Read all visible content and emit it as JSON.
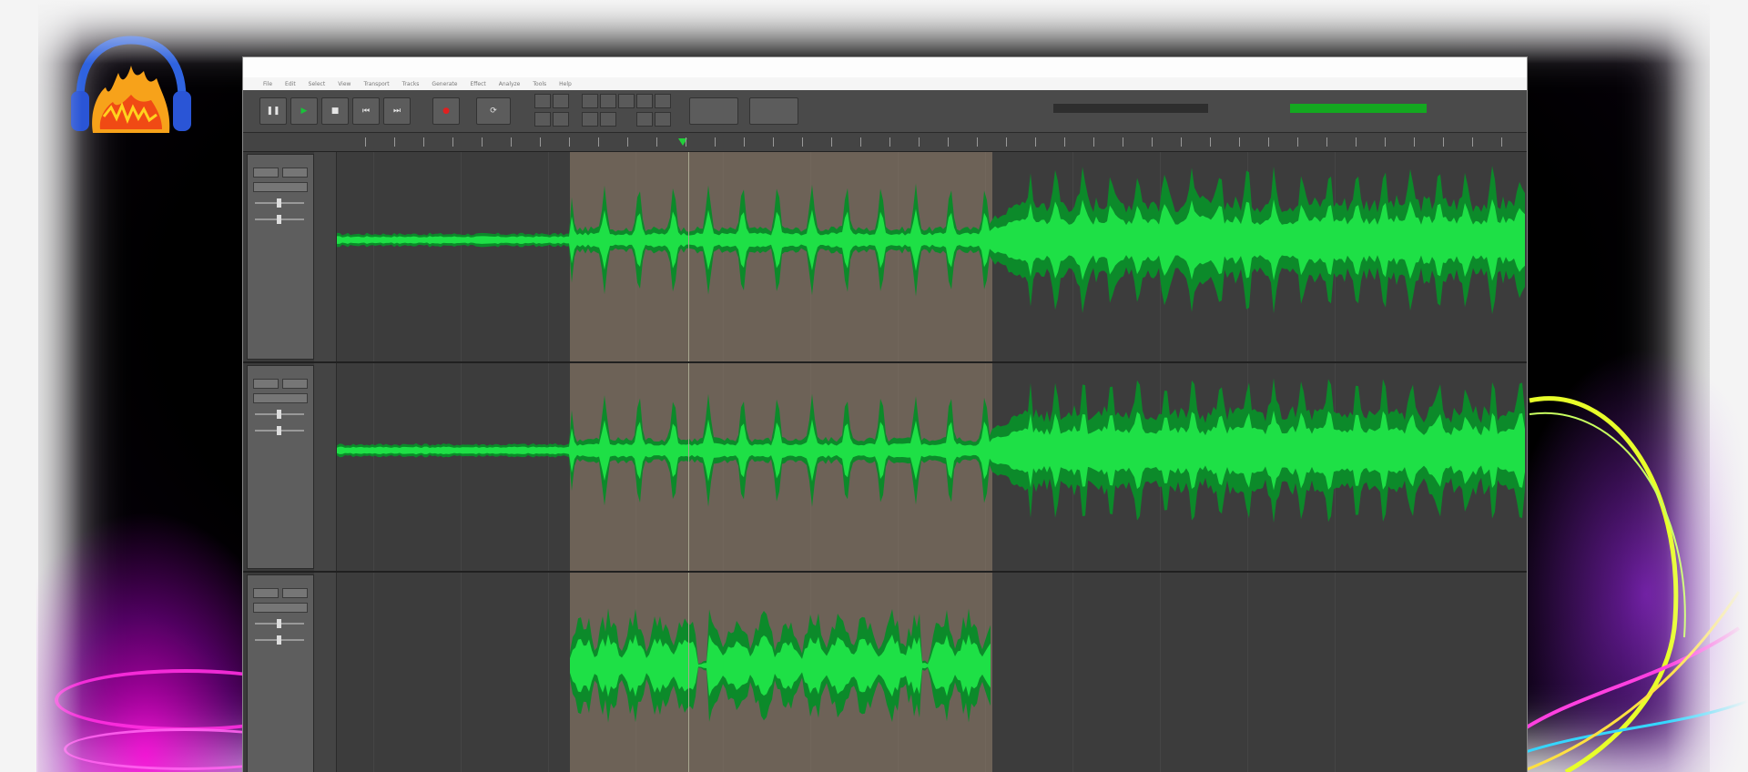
{
  "menus": [
    "File",
    "Edit",
    "Select",
    "View",
    "Transport",
    "Tracks",
    "Generate",
    "Effect",
    "Analyze",
    "Tools",
    "Help"
  ],
  "toolbar": {
    "transport": [
      {
        "name": "pause",
        "glyph": "❚❚"
      },
      {
        "name": "play",
        "glyph": "▶"
      },
      {
        "name": "stop",
        "glyph": "■"
      },
      {
        "name": "skip-start",
        "glyph": "⏮"
      },
      {
        "name": "skip-end",
        "glyph": "⏭"
      },
      {
        "name": "record",
        "glyph": "●"
      },
      {
        "name": "loop",
        "glyph": "⟳"
      }
    ],
    "colors": {
      "play": "#19c23a",
      "record": "#e02020",
      "glyph": "#e5e5e5"
    }
  },
  "tracks": [
    {
      "name": "",
      "clip": "",
      "waveform_color": "#1ee046",
      "waveform_dark": "#0c8a2a"
    },
    {
      "name": "",
      "clip": "",
      "waveform_color": "#1ee046",
      "waveform_dark": "#0c8a2a"
    },
    {
      "name": "",
      "clip": "",
      "waveform_color": "#1ee046",
      "waveform_dark": "#0c8a2a"
    }
  ],
  "colors": {
    "background": "#000000",
    "app_bg": "#3b3b3b",
    "selection": "#968270",
    "waveform": "#1ee046"
  }
}
